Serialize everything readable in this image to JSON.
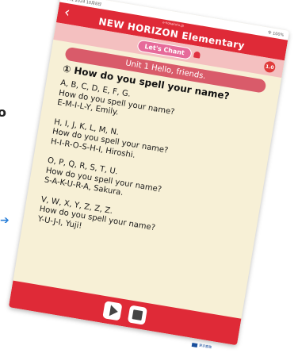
{
  "status_bar": {
    "left": "9:41 2024 10月8日",
    "right": "令 100%"
  },
  "header": {
    "url": "e-hokakutu.jp",
    "title": "NEW HORIZON Elementary",
    "back_icon": "chevron-left-icon"
  },
  "sub_header": {
    "chant_label": "Let's Chant",
    "speed_label": "1.0"
  },
  "unit_title": "Unit 1 Hello, friends.",
  "question": "① How do you spell your name?",
  "stanzas": [
    {
      "line1": "A, B, C, D, E, F, G.",
      "line2": "How do you spell your name?",
      "line3": "E-M-I-L-Y, Emily."
    },
    {
      "line1": "H, I, J, K, L, M, N.",
      "line2": "How do you spell your name?",
      "line3": "H-I-R-O-S-H-I, Hiroshi."
    },
    {
      "line1": "O, P, Q, R, S, T, U.",
      "line2": "How do you spell your name?",
      "line3": "S-A-K-U-R-A, Sakura."
    },
    {
      "line1": "V, W, X, Y, Z, Z, Z.",
      "line2": "How do you spell your name?",
      "line3": "Y-U-J-I, Yuji!"
    }
  ],
  "controls": {
    "play_icon": "play-icon",
    "stop_icon": "stop-icon"
  },
  "footer_copyright": "New HORIZON Elementary 5 © Tokyo Shoseki Co., Ltd. All rights reserved.",
  "corner_logo": "東京書籍",
  "colors": {
    "header": "#df2a37",
    "page": "#f7f0d6",
    "banner": "#d95b6a",
    "chant_badge": "#e66a9a"
  }
}
